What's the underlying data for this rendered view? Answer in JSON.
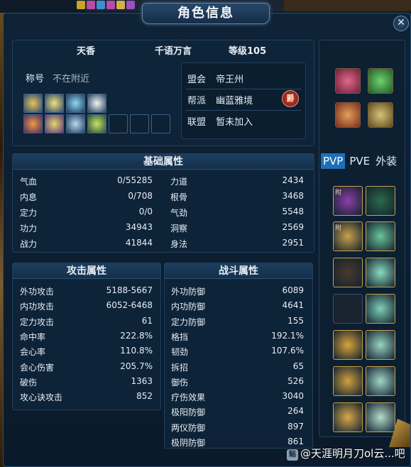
{
  "window": {
    "title": "角色信息",
    "close_label": "✕"
  },
  "profile": {
    "name": "天香",
    "title_name": "千语万言",
    "level": "等级105",
    "title_label": "称号",
    "title_value": "不在附近"
  },
  "buffs": [
    "chakra-buff-icon",
    "star-buff-icon",
    "snowflake-buff-icon",
    "sword-buff-icon",
    "flame-buff-icon",
    "lotus-buff-icon",
    "orb-buff-icon",
    "leaf-buff-icon",
    "",
    "",
    "",
    ""
  ],
  "guild": {
    "alliance_label": "盟会",
    "alliance_value": "帝王州",
    "faction_label": "帮派",
    "faction_value": "幽蓝雅境",
    "league_label": "联盟",
    "league_value": "暂未加入",
    "badge": "爵"
  },
  "basic": {
    "header": "基础属性",
    "left": [
      {
        "k": "气血",
        "v": "0/55285"
      },
      {
        "k": "内息",
        "v": "0/708"
      },
      {
        "k": "定力",
        "v": "0/0"
      },
      {
        "k": "功力",
        "v": "34943"
      },
      {
        "k": "战力",
        "v": "41844"
      }
    ],
    "right": [
      {
        "k": "力道",
        "v": "2434"
      },
      {
        "k": "根骨",
        "v": "3468"
      },
      {
        "k": "气劲",
        "v": "5548"
      },
      {
        "k": "洞察",
        "v": "2569"
      },
      {
        "k": "身法",
        "v": "2951"
      }
    ]
  },
  "attack": {
    "header": "攻击属性",
    "rows": [
      {
        "k": "外功攻击",
        "v": "5188-5667"
      },
      {
        "k": "内功攻击",
        "v": "6052-6468"
      },
      {
        "k": "定力攻击",
        "v": "61"
      },
      {
        "k": "命中率",
        "v": "222.8%"
      },
      {
        "k": "会心率",
        "v": "110.8%"
      },
      {
        "k": "会心伤害",
        "v": "205.7%"
      },
      {
        "k": "破伤",
        "v": "1363"
      },
      {
        "k": "攻心诀攻击",
        "v": "852"
      }
    ]
  },
  "combat": {
    "header": "战斗属性",
    "rows": [
      {
        "k": "外功防御",
        "v": "6089"
      },
      {
        "k": "内功防御",
        "v": "4641"
      },
      {
        "k": "定力防御",
        "v": "155"
      },
      {
        "k": "格挡",
        "v": "192.1%"
      },
      {
        "k": "韧劲",
        "v": "107.6%"
      },
      {
        "k": "拆招",
        "v": "65"
      },
      {
        "k": "御伤",
        "v": "526"
      },
      {
        "k": "疗伤效果",
        "v": "3040"
      },
      {
        "k": "极阳防御",
        "v": "264"
      },
      {
        "k": "两仪防御",
        "v": "897"
      },
      {
        "k": "极阴防御",
        "v": "861"
      }
    ]
  },
  "side_tabs": [
    "PVP",
    "PVE",
    "外装"
  ],
  "equip_mark": "附",
  "watermark": "@天涯明月刀ol云...吧",
  "watermark_icon": "贴",
  "colors": {
    "accent": "#1e6fb8",
    "gold_border": "#caa24b"
  }
}
